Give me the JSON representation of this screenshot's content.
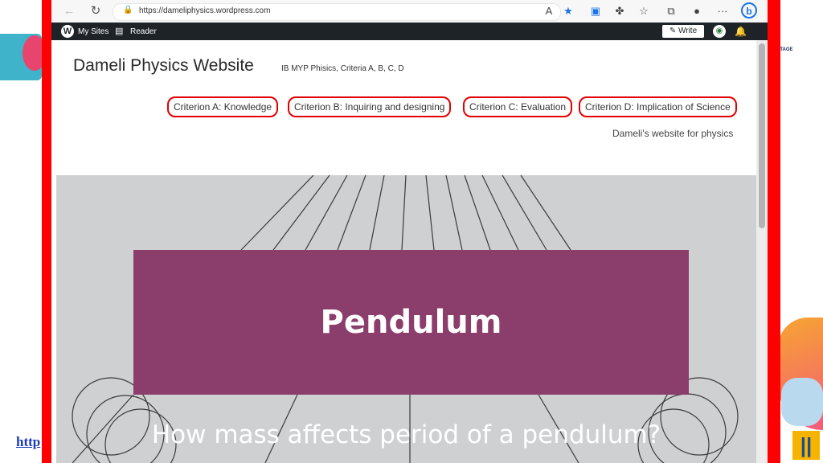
{
  "browser": {
    "url": "https://dameliphysics.wordpress.com"
  },
  "wp_admin_bar": {
    "my_sites": "My Sites",
    "reader": "Reader",
    "write": "Write"
  },
  "site": {
    "title": "Dameli Physics Website",
    "tagline": "IB MYP Phisics, Criteria A, B, C, D",
    "menu": [
      {
        "label": "Criterion A: Knowledge"
      },
      {
        "label": "Criterion B: Inquiring and designing"
      },
      {
        "label": "Criterion C: Evaluation"
      },
      {
        "label": "Criterion D: Implication of Science"
      }
    ],
    "description": "Dameli's website for physics"
  },
  "hero": {
    "title": "Pendulum",
    "subtitle": "How mass affects period of a pendulum?"
  },
  "slide": {
    "link_text": "http"
  },
  "colors": {
    "hero_box": "#8b3d6b",
    "annotation_red": "#ff0000",
    "wp_bar": "#1d2327"
  }
}
